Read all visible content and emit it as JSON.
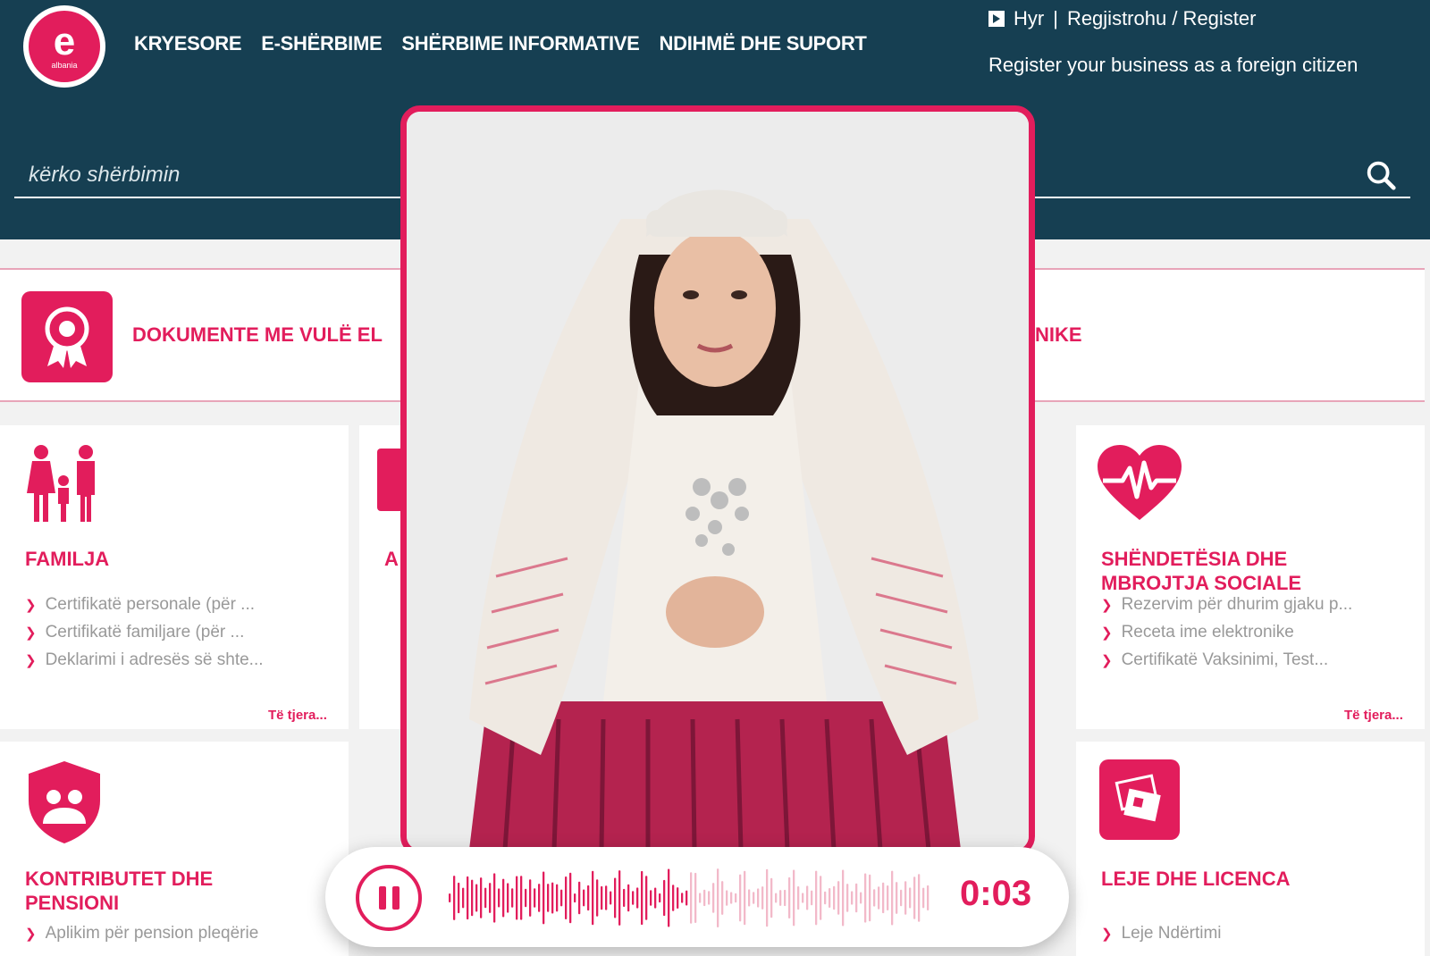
{
  "header": {
    "logo": {
      "letter": "e",
      "sub": "albania"
    },
    "nav": [
      "KRYESORE",
      "E-SHËRBIME",
      "SHËRBIME INFORMATIVE",
      "NDIHMË DHE SUPORT"
    ],
    "login_label": "Hyr",
    "separator": "|",
    "register_label": "Regjistrohu / Register",
    "register_business": "Register your business as a foreign citizen",
    "search_placeholder": "kërko shërbimin"
  },
  "banner": {
    "text_left": "DOKUMENTE ME VULË EL",
    "text_right": "NIKE"
  },
  "cards": {
    "familja": {
      "title": "FAMILJA",
      "links": [
        "Certifikatë personale (për ...",
        "Certifikatë familjare (për ...",
        "Deklarimi i adresës së shte..."
      ],
      "more": "Të tjera..."
    },
    "card2": {
      "title": "A"
    },
    "shendetesia": {
      "title_line1": "SHËNDETËSIA DHE",
      "title_line2": "MBROJTJA SOCIALE",
      "links": [
        "Rezervim për dhurim gjaku p...",
        "Receta ime elektronike",
        "Certifikatë Vaksinimi, Test..."
      ],
      "more": "Të tjera..."
    },
    "kontributet": {
      "title_line1": "KONTRIBUTET DHE",
      "title_line2": "PENSIONI",
      "links": [
        "Aplikim për pension pleqërie"
      ]
    },
    "leje": {
      "title": "LEJE DHE LICENCA",
      "links": [
        "Leje Ndërtimi"
      ]
    }
  },
  "player": {
    "time": "0:03",
    "progress": 0.5
  },
  "colors": {
    "header_bg": "#163f52",
    "accent": "#e21d5c"
  }
}
